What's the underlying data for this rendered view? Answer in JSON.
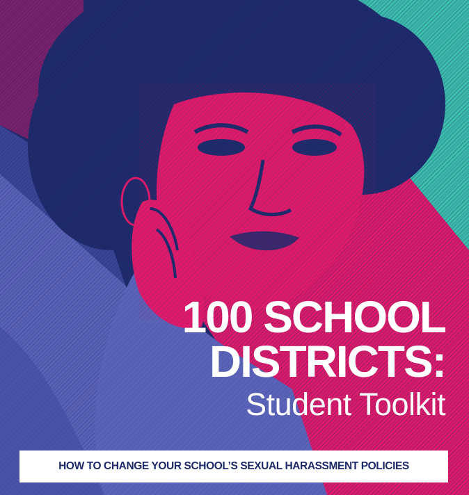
{
  "cover": {
    "title_line_1": "100 SCHOOL",
    "title_line_2": "DISTRICTS:",
    "subtitle": "Student Toolkit",
    "banner": "HOW TO CHANGE YOUR SCHOOL’S SEXUAL HARASSMENT POLICIES"
  },
  "colors": {
    "navy": "#1f2a6b",
    "magenta": "#df1a6a",
    "teal": "#3cbfad",
    "periwinkle": "#5a63b8",
    "white": "#ffffff"
  }
}
